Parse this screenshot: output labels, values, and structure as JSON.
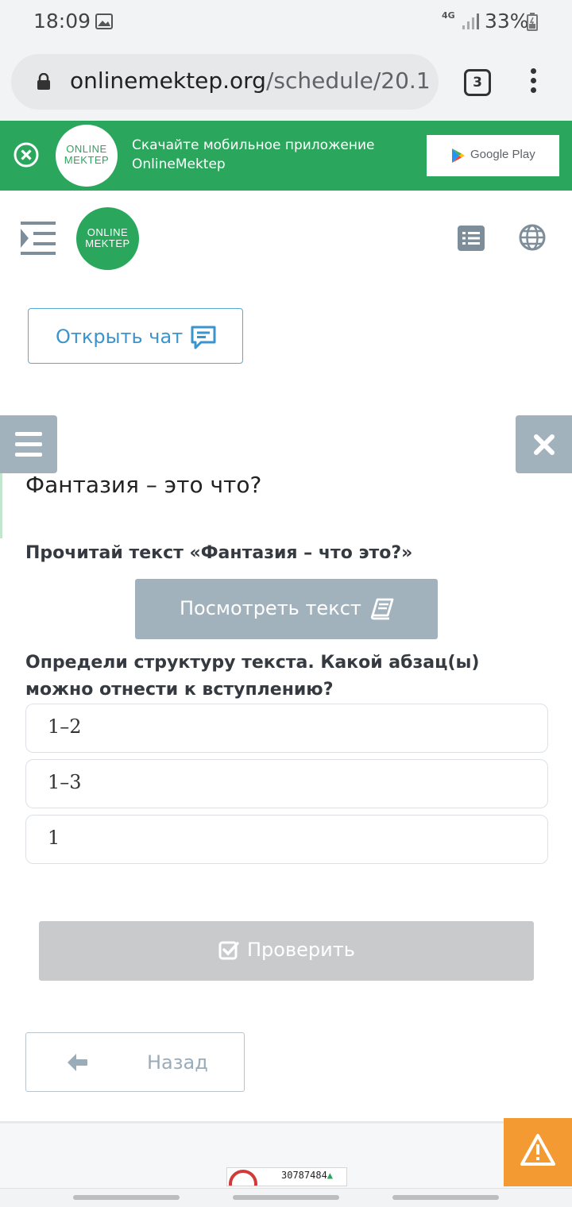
{
  "status_bar": {
    "time": "18:09",
    "network": "4G",
    "battery": "33%"
  },
  "browser": {
    "url_host": "onlinemektep.org",
    "url_path": "/schedule/20.1",
    "tab_count": "3"
  },
  "app_banner": {
    "logo_line1": "ONLINE",
    "logo_line2": "MEKTEP",
    "text_line1": "Скачайте мобильное приложение",
    "text_line2": "OnlineMektep",
    "store_label": "Google Play"
  },
  "header": {
    "logo_line1": "ONLINE",
    "logo_line2": "MEKTEP"
  },
  "chat_button": {
    "label": "Открыть чат"
  },
  "lesson": {
    "title": "Фантазия – это что?",
    "instruction": "Прочитай текст «Фантазия – что это?»",
    "view_text_label": "Посмотреть текст",
    "question": "Определи структуру текста. Какой абзац(ы) можно отнести к вступлению?",
    "options": [
      {
        "label": "1–2"
      },
      {
        "label": "1–3"
      },
      {
        "label": "1"
      }
    ],
    "check_label": "Проверить",
    "back_label": "Назад"
  },
  "footer": {
    "counter_value": "30787484"
  },
  "colors": {
    "brand_green": "#2aa75c",
    "gray_button": "#a2b2bd",
    "link_blue": "#3a95cc",
    "warning_orange": "#f39a33"
  }
}
